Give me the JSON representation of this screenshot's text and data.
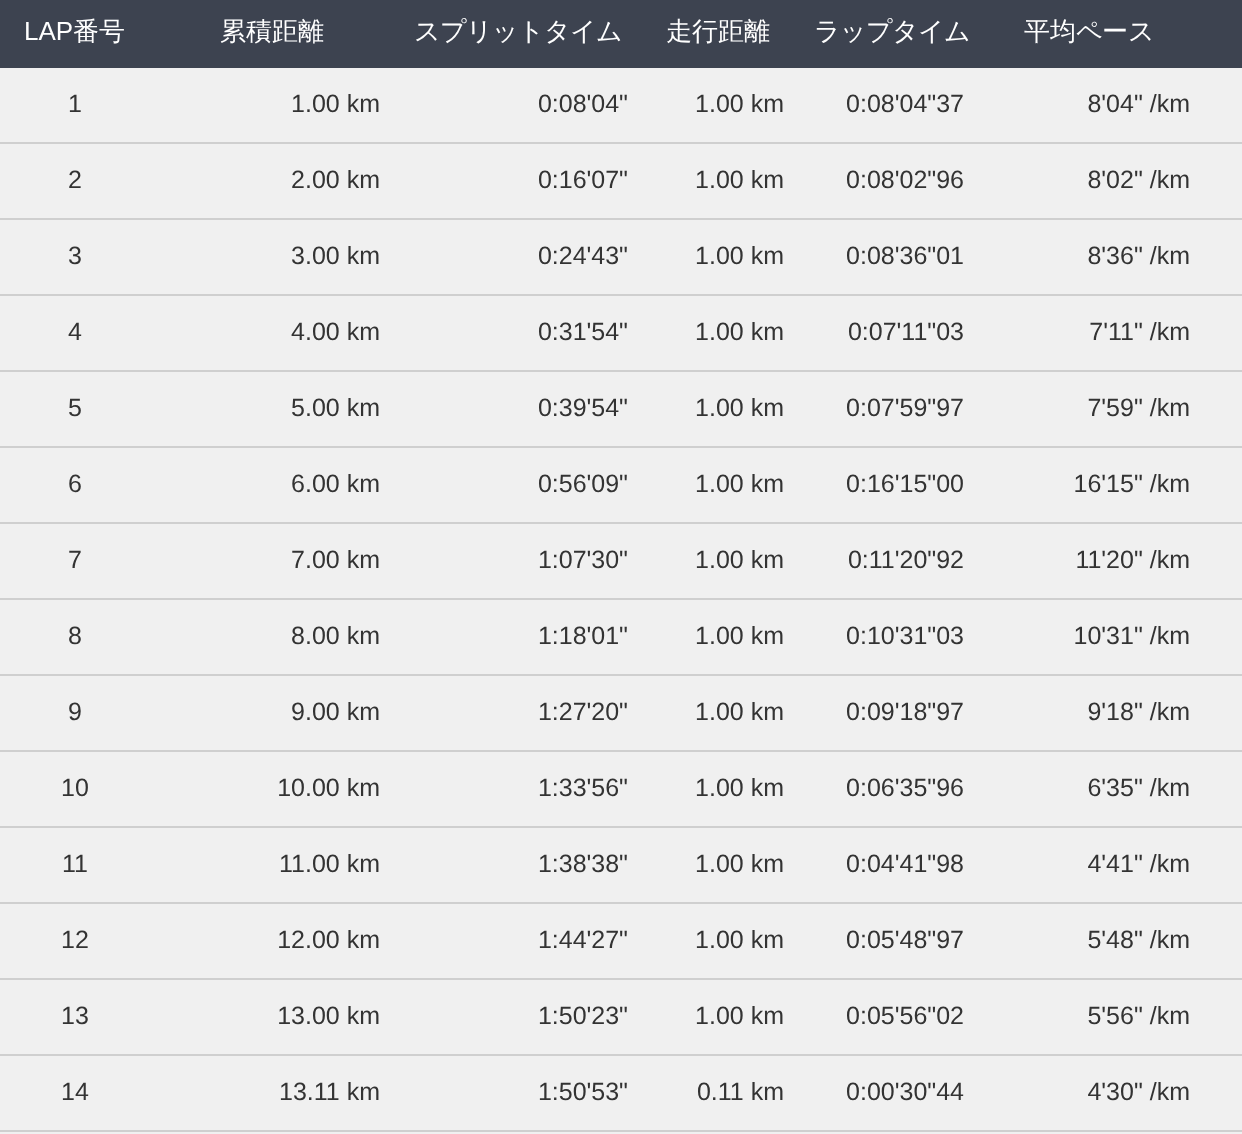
{
  "table": {
    "columns": [
      "LAP番号",
      "累積距離",
      "スプリットタイム",
      "走行距離",
      "ラップタイム",
      "平均ペース"
    ],
    "rows": [
      [
        "1",
        "1.00 km",
        "0:08'04\"",
        "1.00 km",
        "0:08'04\"37",
        "8'04\" /km"
      ],
      [
        "2",
        "2.00 km",
        "0:16'07\"",
        "1.00 km",
        "0:08'02\"96",
        "8'02\" /km"
      ],
      [
        "3",
        "3.00 km",
        "0:24'43\"",
        "1.00 km",
        "0:08'36\"01",
        "8'36\" /km"
      ],
      [
        "4",
        "4.00 km",
        "0:31'54\"",
        "1.00 km",
        "0:07'11\"03",
        "7'11\" /km"
      ],
      [
        "5",
        "5.00 km",
        "0:39'54\"",
        "1.00 km",
        "0:07'59\"97",
        "7'59\" /km"
      ],
      [
        "6",
        "6.00 km",
        "0:56'09\"",
        "1.00 km",
        "0:16'15\"00",
        "16'15\" /km"
      ],
      [
        "7",
        "7.00 km",
        "1:07'30\"",
        "1.00 km",
        "0:11'20\"92",
        "11'20\" /km"
      ],
      [
        "8",
        "8.00 km",
        "1:18'01\"",
        "1.00 km",
        "0:10'31\"03",
        "10'31\" /km"
      ],
      [
        "9",
        "9.00 km",
        "1:27'20\"",
        "1.00 km",
        "0:09'18\"97",
        "9'18\" /km"
      ],
      [
        "10",
        "10.00 km",
        "1:33'56\"",
        "1.00 km",
        "0:06'35\"96",
        "6'35\" /km"
      ],
      [
        "11",
        "11.00 km",
        "1:38'38\"",
        "1.00 km",
        "0:04'41\"98",
        "4'41\" /km"
      ],
      [
        "12",
        "12.00 km",
        "1:44'27\"",
        "1.00 km",
        "0:05'48\"97",
        "5'48\" /km"
      ],
      [
        "13",
        "13.00 km",
        "1:50'23\"",
        "1.00 km",
        "0:05'56\"02",
        "5'56\" /km"
      ],
      [
        "14",
        "13.11 km",
        "1:50'53\"",
        "0.11 km",
        "0:00'30\"44",
        "4'30\" /km"
      ]
    ]
  }
}
